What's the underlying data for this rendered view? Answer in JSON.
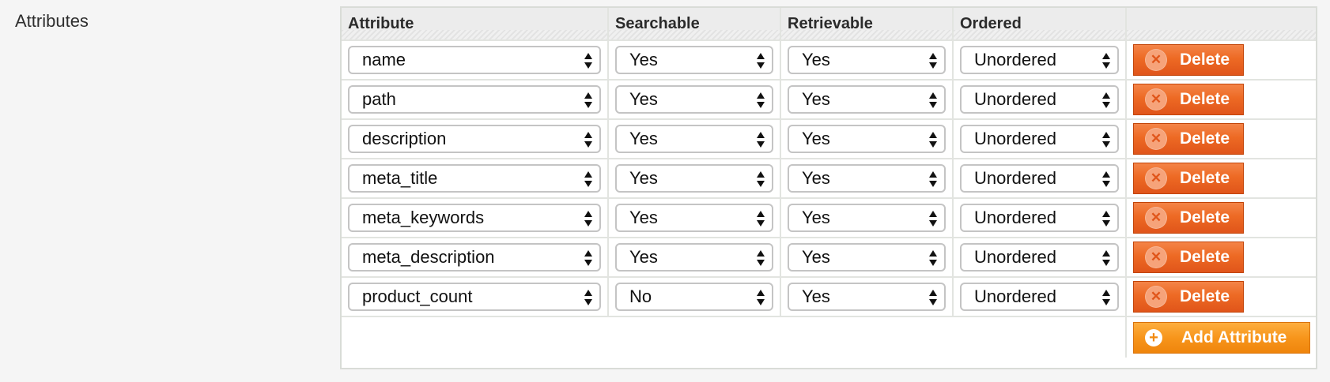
{
  "section": {
    "label": "Attributes"
  },
  "columns": [
    "Attribute",
    "Searchable",
    "Retrievable",
    "Ordered",
    ""
  ],
  "rows": [
    {
      "attribute": "name",
      "searchable": "Yes",
      "retrievable": "Yes",
      "ordered": "Unordered"
    },
    {
      "attribute": "path",
      "searchable": "Yes",
      "retrievable": "Yes",
      "ordered": "Unordered"
    },
    {
      "attribute": "description",
      "searchable": "Yes",
      "retrievable": "Yes",
      "ordered": "Unordered"
    },
    {
      "attribute": "meta_title",
      "searchable": "Yes",
      "retrievable": "Yes",
      "ordered": "Unordered"
    },
    {
      "attribute": "meta_keywords",
      "searchable": "Yes",
      "retrievable": "Yes",
      "ordered": "Unordered"
    },
    {
      "attribute": "meta_description",
      "searchable": "Yes",
      "retrievable": "Yes",
      "ordered": "Unordered"
    },
    {
      "attribute": "product_count",
      "searchable": "No",
      "retrievable": "Yes",
      "ordered": "Unordered"
    }
  ],
  "buttons": {
    "delete_label": "Delete",
    "add_label": "Add Attribute",
    "delete_icon": "close-circle-icon",
    "add_icon": "plus-circle-icon"
  },
  "colors": {
    "delete_button": "#ed6a24",
    "add_button": "#f7951b"
  }
}
